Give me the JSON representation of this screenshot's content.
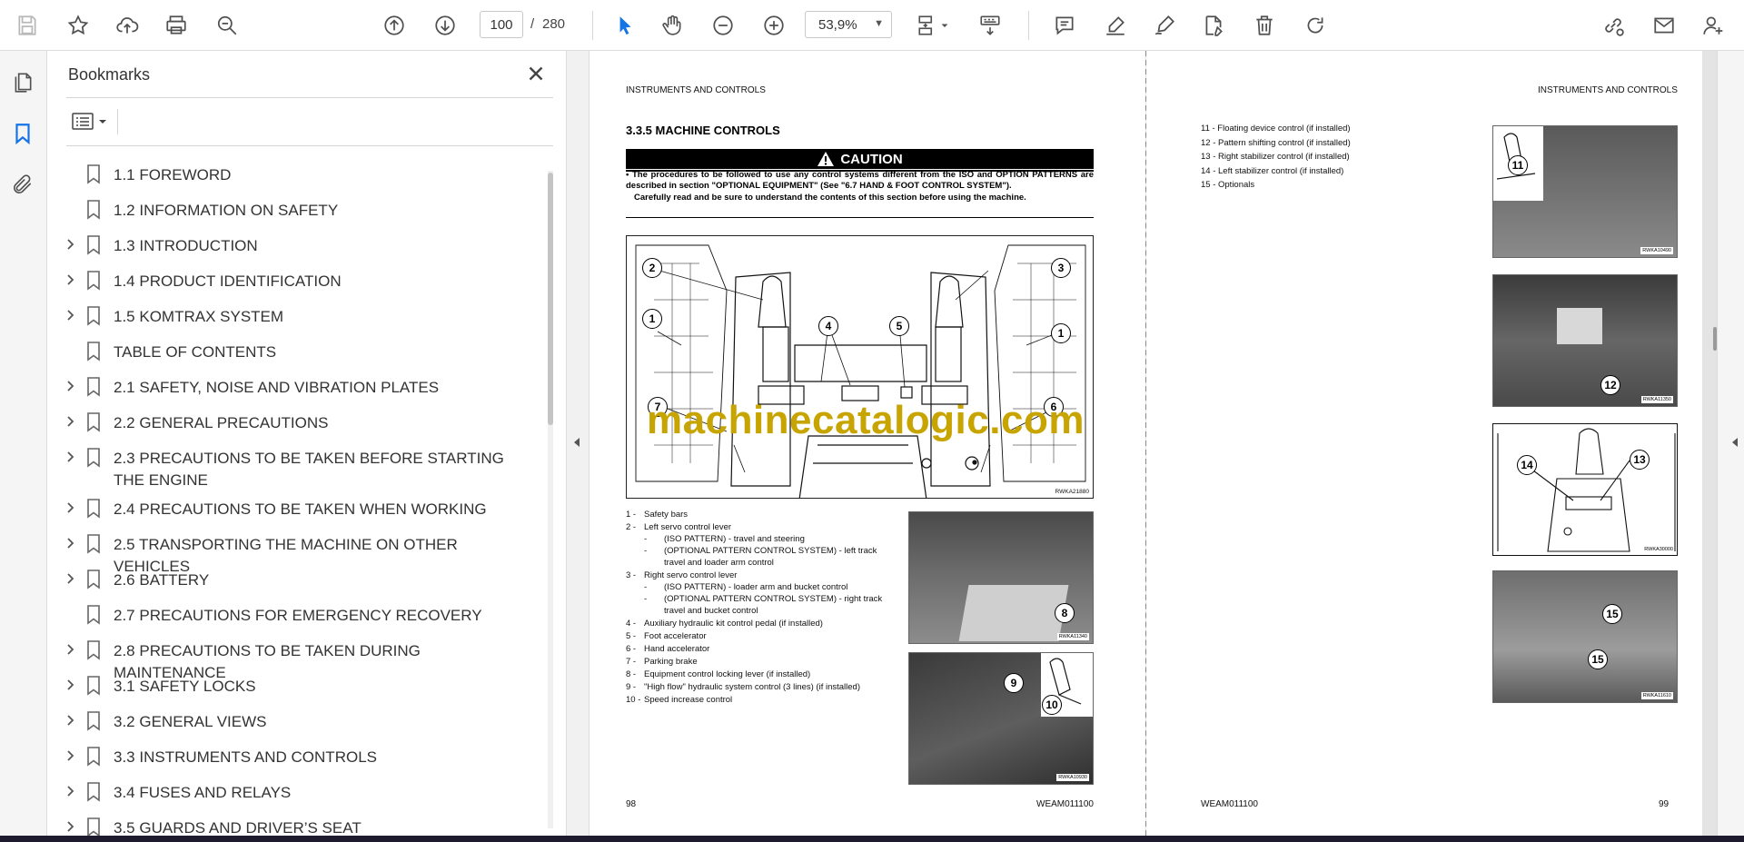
{
  "toolbar": {
    "page_current": "100",
    "page_total": "280",
    "zoom": "53,9%"
  },
  "bookmarks": {
    "title": "Bookmarks",
    "items": [
      {
        "label": "1.1 FOREWORD",
        "expandable": false
      },
      {
        "label": "1.2 INFORMATION ON SAFETY",
        "expandable": false
      },
      {
        "label": "1.3 INTRODUCTION",
        "expandable": true
      },
      {
        "label": "1.4 PRODUCT IDENTIFICATION",
        "expandable": true
      },
      {
        "label": "1.5 KOMTRAX SYSTEM",
        "expandable": true
      },
      {
        "label": "TABLE OF CONTENTS",
        "expandable": false
      },
      {
        "label": "2.1 SAFETY, NOISE AND VIBRATION PLATES",
        "expandable": true
      },
      {
        "label": "2.2 GENERAL PRECAUTIONS",
        "expandable": true
      },
      {
        "label": "2.3 PRECAUTIONS TO BE TAKEN BEFORE STARTING THE ENGINE",
        "expandable": true
      },
      {
        "label": "2.4 PRECAUTIONS TO BE TAKEN WHEN WORKING",
        "expandable": true
      },
      {
        "label": "2.5 TRANSPORTING THE MACHINE ON OTHER VEHICLES",
        "expandable": true
      },
      {
        "label": "2.6 BATTERY",
        "expandable": true
      },
      {
        "label": "2.7 PRECAUTIONS FOR EMERGENCY RECOVERY",
        "expandable": false
      },
      {
        "label": "2.8 PRECAUTIONS TO BE TAKEN DURING MAINTENANCE",
        "expandable": true
      },
      {
        "label": "3.1 SAFETY LOCKS",
        "expandable": true
      },
      {
        "label": "3.2 GENERAL VIEWS",
        "expandable": true
      },
      {
        "label": "3.3 INSTRUMENTS AND CONTROLS",
        "expandable": true
      },
      {
        "label": "3.4 FUSES AND RELAYS",
        "expandable": true
      },
      {
        "label": "3.5 GUARDS AND DRIVER’S SEAT",
        "expandable": true
      }
    ]
  },
  "doc": {
    "left": {
      "header": "INSTRUMENTS AND CONTROLS",
      "section_title": "3.3.5   MACHINE CONTROLS",
      "caution_label": "CAUTION",
      "caution_line1": "• The procedures to be followed to use any control systems different from the ISO and OPTION PATTERNS are described in section \"OPTIONAL EQUIPMENT\" (See \"6.7 HAND & FOOT CONTROL SYSTEM\").",
      "caution_line2": "Carefully read and be sure to understand the contents of this section before using the machine.",
      "main_figure_code": "RWKA21880",
      "photo8_code": "RWKA11340",
      "photo9_code": "RWKA10930",
      "footer_page": "98",
      "footer_code": "WEAM011100",
      "list": [
        {
          "num": "1 -",
          "text": "Safety bars",
          "sub": false
        },
        {
          "num": "2 -",
          "text": "Left servo control lever",
          "sub": false
        },
        {
          "num": "-",
          "text": "(ISO PATTERN) - travel and steering",
          "sub": true
        },
        {
          "num": "-",
          "text": "(OPTIONAL PATTERN CONTROL SYSTEM) - left track travel and loader arm control",
          "sub": true
        },
        {
          "num": "3 -",
          "text": "Right servo control lever",
          "sub": false
        },
        {
          "num": "-",
          "text": "(ISO PATTERN) - loader arm and bucket control",
          "sub": true
        },
        {
          "num": "-",
          "text": "(OPTIONAL PATTERN CONTROL SYSTEM) - right track travel and bucket control",
          "sub": true
        },
        {
          "num": "4 -",
          "text": "Auxiliary hydraulic kit control pedal (if installed)",
          "sub": false
        },
        {
          "num": "5 -",
          "text": "Foot accelerator",
          "sub": false
        },
        {
          "num": "6 -",
          "text": "Hand accelerator",
          "sub": false
        },
        {
          "num": "7 -",
          "text": "Parking brake",
          "sub": false
        },
        {
          "num": "8 -",
          "text": "Equipment control locking lever (if installed)",
          "sub": false
        },
        {
          "num": "9 -",
          "text": "\"High flow\" hydraulic system control (3 lines) (if installed)",
          "sub": false
        },
        {
          "num": "10 -",
          "text": "Speed increase control",
          "sub": false
        }
      ],
      "callouts": [
        "1",
        "2",
        "3",
        "4",
        "5",
        "6",
        "7",
        "8",
        "9",
        "10"
      ]
    },
    "right": {
      "header": "INSTRUMENTS AND CONTROLS",
      "footer_page": "99",
      "footer_code": "WEAM011100",
      "list": [
        "11 - Floating device control (if installed)",
        "12 - Pattern shifting control (if installed)",
        "13 - Right stabilizer control (if installed)",
        "14 - Left stabilizer control (if installed)",
        "15 - Optionals"
      ],
      "photo_codes": [
        "RWKA10490",
        "RWKA11350",
        "RWKA30000",
        "RWKA11610"
      ],
      "callouts": [
        "11",
        "12",
        "13",
        "14",
        "15"
      ]
    },
    "watermark": "machinecatalogic.com"
  }
}
